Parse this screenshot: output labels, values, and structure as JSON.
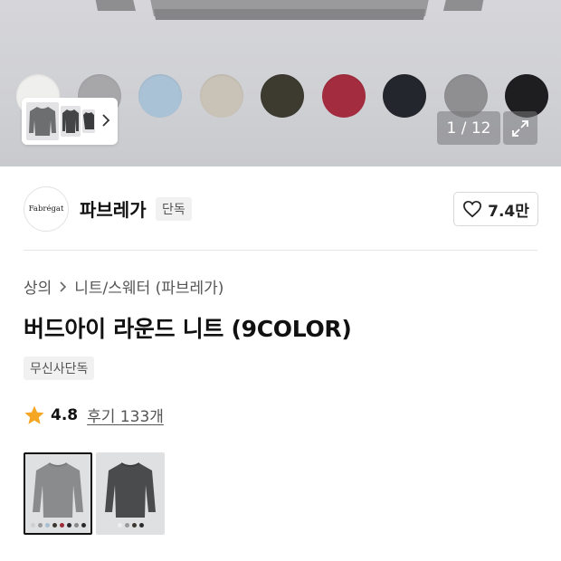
{
  "gallery": {
    "swatches": [
      {
        "name": "white",
        "color": "#efefed"
      },
      {
        "name": "light-gray",
        "color": "#a7a7a9"
      },
      {
        "name": "sky-blue",
        "color": "#aac2d6"
      },
      {
        "name": "beige",
        "color": "#c8c2b7"
      },
      {
        "name": "khaki",
        "color": "#3d3a30"
      },
      {
        "name": "burgundy",
        "color": "#a32d3e"
      },
      {
        "name": "navy",
        "color": "#23262c"
      },
      {
        "name": "gray",
        "color": "#8f8f91"
      },
      {
        "name": "black",
        "color": "#1e1e20"
      }
    ],
    "pager": "1 / 12",
    "thumb_strip_icon": "chevron-right-icon",
    "expand_icon": "expand-icon"
  },
  "brand": {
    "logo_text": "Fabrégat",
    "name": "파브레가",
    "badge": "단독",
    "likes": "7.4만",
    "like_icon": "heart-icon"
  },
  "product": {
    "breadcrumb": [
      "상의",
      "니트/스웨터 (파브레가)"
    ],
    "title": "버드아이 라운드 니트 (9COLOR)",
    "exclusive_badge": "무신사단독",
    "rating": "4.8",
    "reviews": "후기 133개",
    "rating_icon": "star-icon",
    "rating_color": "#f5a623"
  },
  "variants": [
    {
      "selected": true,
      "body_color": "#8a8b8d",
      "dots": [
        "#cfcfcf",
        "#9a9a9a",
        "#a9bfd2",
        "#3b382f",
        "#9b2b3a",
        "#26282c",
        "#8a8a8a",
        "#2a2a2a"
      ]
    },
    {
      "selected": false,
      "body_color": "#4a4b4c",
      "dots": [
        "#eeeeee",
        "#9a9a9a",
        "#3b382f",
        "#2a2a2a"
      ]
    }
  ]
}
